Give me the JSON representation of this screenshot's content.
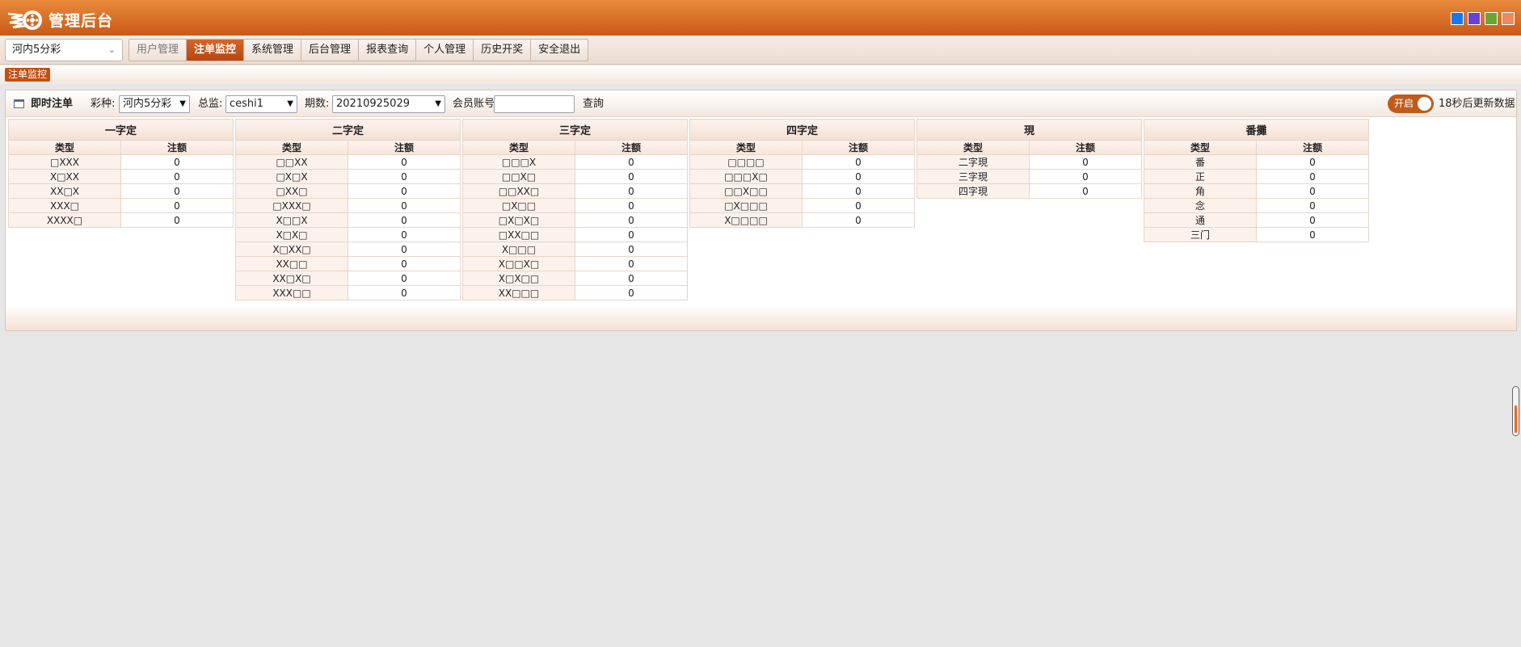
{
  "header": {
    "title": "管理后台",
    "theme_colors": [
      "#1877f2",
      "#6b3fd1",
      "#6aa531",
      "#f0885a"
    ]
  },
  "nav": {
    "lottery_select": "河内5分彩",
    "menu": [
      {
        "label": "用户管理",
        "state": "muted"
      },
      {
        "label": "注单监控",
        "state": "active"
      },
      {
        "label": "系统管理",
        "state": "normal"
      },
      {
        "label": "后台管理",
        "state": "normal"
      },
      {
        "label": "报表查询",
        "state": "normal"
      },
      {
        "label": "个人管理",
        "state": "normal"
      },
      {
        "label": "历史开奖",
        "state": "normal"
      },
      {
        "label": "安全退出",
        "state": "normal"
      }
    ]
  },
  "breadcrumb": "注单监控",
  "toolbar": {
    "title": "即时注单",
    "lottery_label": "彩种:",
    "lottery_value": "河内5分彩",
    "director_label": "总监:",
    "director_value": "ceshi1",
    "period_label": "期数:",
    "period_value": "20210925029",
    "member_label": "会员账号:",
    "member_value": "",
    "query_label": "查詢",
    "toggle_label": "开启",
    "refresh_text": "18秒后更新数据"
  },
  "tables": [
    {
      "title": "一字定",
      "col_type": "类型",
      "col_amount": "注额",
      "rows": [
        [
          "□XXX",
          "0"
        ],
        [
          "X□XX",
          "0"
        ],
        [
          "XX□X",
          "0"
        ],
        [
          "XXX□",
          "0"
        ],
        [
          "XXXX□",
          "0"
        ]
      ]
    },
    {
      "title": "二字定",
      "col_type": "类型",
      "col_amount": "注额",
      "rows": [
        [
          "□□XX",
          "0"
        ],
        [
          "□X□X",
          "0"
        ],
        [
          "□XX□",
          "0"
        ],
        [
          "□XXX□",
          "0"
        ],
        [
          "X□□X",
          "0"
        ],
        [
          "X□X□",
          "0"
        ],
        [
          "X□XX□",
          "0"
        ],
        [
          "XX□□",
          "0"
        ],
        [
          "XX□X□",
          "0"
        ],
        [
          "XXX□□",
          "0"
        ]
      ]
    },
    {
      "title": "三字定",
      "col_type": "类型",
      "col_amount": "注额",
      "rows": [
        [
          "□□□X",
          "0"
        ],
        [
          "□□X□",
          "0"
        ],
        [
          "□□XX□",
          "0"
        ],
        [
          "□X□□",
          "0"
        ],
        [
          "□X□X□",
          "0"
        ],
        [
          "□XX□□",
          "0"
        ],
        [
          "X□□□",
          "0"
        ],
        [
          "X□□X□",
          "0"
        ],
        [
          "X□X□□",
          "0"
        ],
        [
          "XX□□□",
          "0"
        ]
      ]
    },
    {
      "title": "四字定",
      "col_type": "类型",
      "col_amount": "注额",
      "rows": [
        [
          "□□□□",
          "0"
        ],
        [
          "□□□X□",
          "0"
        ],
        [
          "□□X□□",
          "0"
        ],
        [
          "□X□□□",
          "0"
        ],
        [
          "X□□□□",
          "0"
        ]
      ]
    },
    {
      "title": "現",
      "col_type": "类型",
      "col_amount": "注额",
      "rows": [
        [
          "二字現",
          "0"
        ],
        [
          "三字現",
          "0"
        ],
        [
          "四字現",
          "0"
        ]
      ]
    },
    {
      "title": "番攤",
      "col_type": "类型",
      "col_amount": "注额",
      "rows": [
        [
          "番",
          "0"
        ],
        [
          "正",
          "0"
        ],
        [
          "角",
          "0"
        ],
        [
          "念",
          "0"
        ],
        [
          "通",
          "0"
        ],
        [
          "三门",
          "0"
        ]
      ]
    }
  ]
}
